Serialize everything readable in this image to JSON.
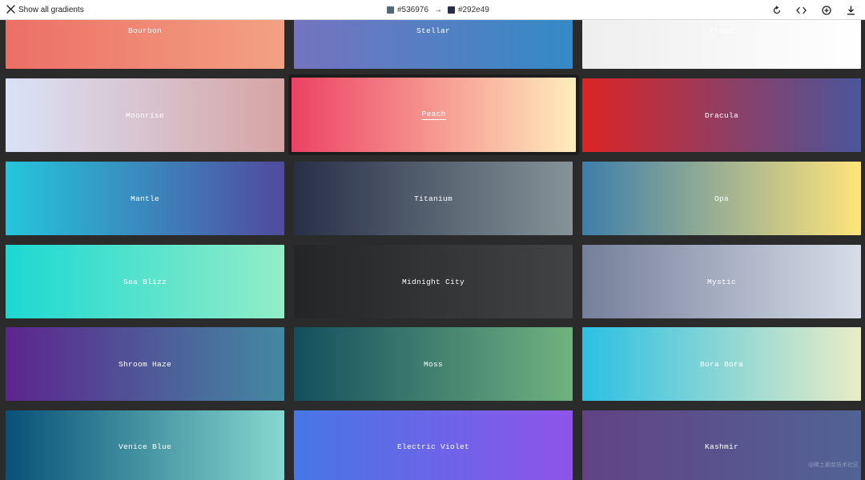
{
  "topbar": {
    "back_label": "Show all gradients",
    "from_color": "#536976",
    "to_color": "#292e49",
    "arrow": "→",
    "icons": [
      "rotate-icon",
      "code-icon",
      "add-icon",
      "download-icon"
    ]
  },
  "gradients": [
    {
      "name": "Bourbon",
      "colors": [
        "#ec6f66",
        "#f3a183"
      ]
    },
    {
      "name": "Stellar",
      "colors": [
        "#7474bf",
        "#348ac7"
      ]
    },
    {
      "name": "Frost",
      "colors": [
        "#eeeeee",
        "#ffffff"
      ]
    },
    {
      "name": "Moonrise",
      "colors": [
        "#dae2f8",
        "#d6a4a4"
      ]
    },
    {
      "name": "Peach",
      "colors": [
        "#ed4264",
        "#ffedbc"
      ]
    },
    {
      "name": "Dracula",
      "colors": [
        "#dc2424",
        "#4a569d"
      ]
    },
    {
      "name": "Mantle",
      "colors": [
        "#24c6dc",
        "#514a9d"
      ]
    },
    {
      "name": "Titanium",
      "colors": [
        "#283048",
        "#859398"
      ]
    },
    {
      "name": "Opa",
      "colors": [
        "#3d7eaa",
        "#ffe47a"
      ]
    },
    {
      "name": "Sea Blizz",
      "colors": [
        "#1cd8d2",
        "#93edc7"
      ]
    },
    {
      "name": "Midnight City",
      "colors": [
        "#232526",
        "#414345"
      ]
    },
    {
      "name": "Mystic",
      "colors": [
        "#757f9a",
        "#d7dde8"
      ]
    },
    {
      "name": "Shroom Haze",
      "colors": [
        "#5c258d",
        "#4389a2"
      ]
    },
    {
      "name": "Moss",
      "colors": [
        "#134e5e",
        "#71b280"
      ]
    },
    {
      "name": "Bora Bora",
      "colors": [
        "#2bc0e4",
        "#eaecc6"
      ]
    },
    {
      "name": "Venice Blue",
      "colors": [
        "#085078",
        "#85d8ce"
      ]
    },
    {
      "name": "Electric Violet",
      "colors": [
        "#4776e6",
        "#8e54e9"
      ]
    },
    {
      "name": "Kashmir",
      "colors": [
        "#614385",
        "#516395"
      ]
    }
  ],
  "active_gradient": "Peach",
  "watermark": "@稀土掘金技术社区"
}
